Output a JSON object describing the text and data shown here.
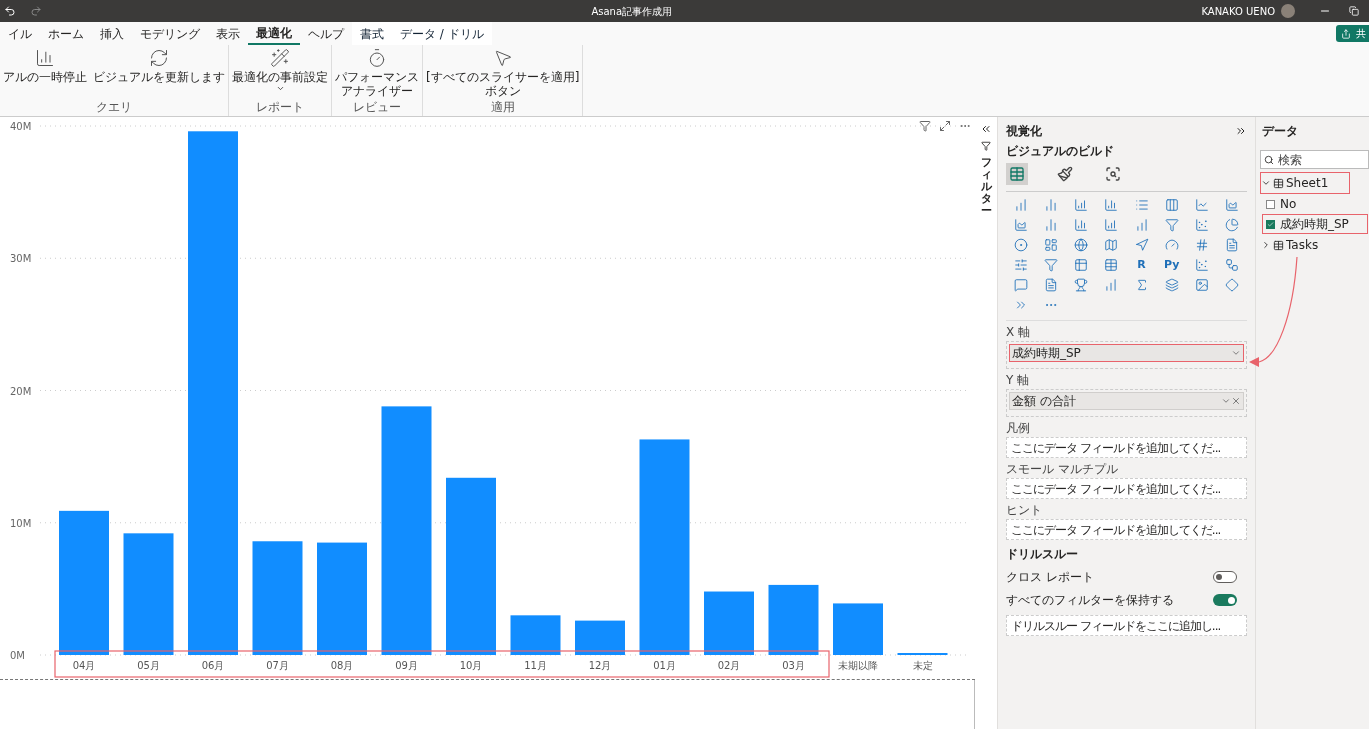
{
  "title_bar": {
    "title": "Asana記事作成用",
    "user": "KANAKO UENO"
  },
  "ribbon_tabs": [
    {
      "label": "イル",
      "selected": false,
      "contextual": false
    },
    {
      "label": "ホーム",
      "selected": false,
      "contextual": false
    },
    {
      "label": "挿入",
      "selected": false,
      "contextual": false
    },
    {
      "label": "モデリング",
      "selected": false,
      "contextual": false
    },
    {
      "label": "表示",
      "selected": false,
      "contextual": false
    },
    {
      "label": "最適化",
      "selected": true,
      "contextual": false
    },
    {
      "label": "ヘルプ",
      "selected": false,
      "contextual": false
    },
    {
      "label": "書式",
      "selected": false,
      "contextual": true
    },
    {
      "label": "データ / ドリル",
      "selected": false,
      "contextual": true
    }
  ],
  "share_button": {
    "label": "共"
  },
  "ribbon_groups": [
    {
      "label": "クエリ",
      "buttons": [
        {
          "lines": [
            "アルの一時停止"
          ],
          "kind": "pause"
        },
        {
          "lines": [
            "ビジュアルを更新します"
          ],
          "kind": "refresh"
        }
      ]
    },
    {
      "label": "レポート",
      "buttons": [
        {
          "lines": [
            "最適化の事前設定"
          ],
          "kind": "presets"
        }
      ]
    },
    {
      "label": "レビュー",
      "buttons": [
        {
          "lines": [
            "パフォーマンス",
            "アナライザー"
          ],
          "kind": "analyzer"
        }
      ]
    },
    {
      "label": "適用",
      "buttons": [
        {
          "lines": [
            "[すべてのスライサーを適用]",
            "ボタン"
          ],
          "kind": "apply"
        }
      ]
    }
  ],
  "chart": {
    "chart_data": {
      "type": "bar",
      "categories": [
        "04月",
        "05月",
        "06月",
        "07月",
        "08月",
        "09月",
        "10月",
        "11月",
        "12月",
        "01月",
        "02月",
        "03月",
        "未期以降",
        "未定"
      ],
      "grid": true,
      "series": [
        {
          "color": "#118dff",
          "values": [
            10900000,
            9200000,
            39600000,
            8600000,
            8500000,
            18800000,
            13400000,
            3000000,
            2600000,
            16300000,
            4800000,
            5300000,
            3900000,
            150000
          ]
        }
      ],
      "ylim": [
        0,
        40000000
      ],
      "yticks": [
        {
          "value": 0,
          "label": "0M"
        },
        {
          "value": 10000000,
          "label": "10M"
        },
        {
          "value": 20000000,
          "label": "20M"
        },
        {
          "value": 30000000,
          "label": "30M"
        },
        {
          "value": 40000000,
          "label": "40M"
        }
      ]
    }
  },
  "filters": {
    "label": "フィルター"
  },
  "visualizations": {
    "title": "視覚化",
    "subtitle": "ビジュアルのビルド",
    "build_tabs": [
      {
        "kind": "fields",
        "selected": true
      },
      {
        "kind": "format",
        "selected": false
      },
      {
        "kind": "analytics",
        "selected": false
      }
    ],
    "script_visuals": [
      {
        "label": "R"
      },
      {
        "label": "Py"
      }
    ],
    "wells": [
      {
        "label": "X 軸",
        "kind": "field",
        "value": "成約時期_SP",
        "highlighted": true,
        "removable": false
      },
      {
        "label": "Y 軸",
        "kind": "field",
        "value": "金額 の合計",
        "highlighted": false,
        "removable": true
      },
      {
        "label": "凡例",
        "kind": "empty",
        "placeholder": "ここにデータ フィールドを追加してくだ..."
      },
      {
        "label": "スモール マルチプル",
        "kind": "empty",
        "placeholder": "ここにデータ フィールドを追加してくだ..."
      },
      {
        "label": "ヒント",
        "kind": "empty",
        "placeholder": "ここにデータ フィールドを追加してくだ..."
      }
    ],
    "drill_through": {
      "title": "ドリルスルー",
      "toggles": [
        {
          "label": "クロス レポート",
          "on": false
        },
        {
          "label": "すべてのフィルターを保持する",
          "on": true
        }
      ],
      "placeholder": "ドリルスルー フィールドをここに追加し..."
    }
  },
  "data": {
    "title": "データ",
    "search": {
      "placeholder": "検索"
    },
    "tables": [
      {
        "name": "Sheet1",
        "expanded": true,
        "highlighted": true,
        "fields": [
          {
            "name": "No",
            "checked": false,
            "highlighted": false
          },
          {
            "name": "成約時期_SP",
            "checked": true,
            "highlighted": true
          }
        ]
      },
      {
        "name": "Tasks",
        "expanded": false,
        "highlighted": false
      }
    ]
  }
}
